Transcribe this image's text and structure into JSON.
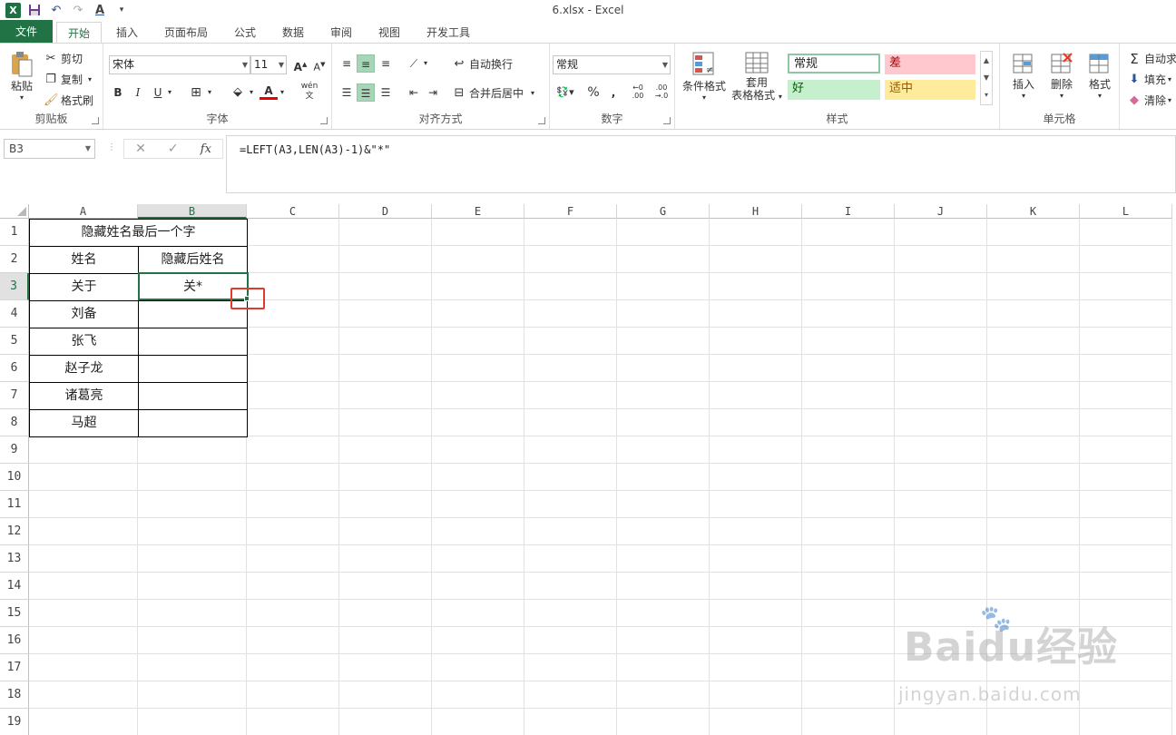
{
  "window": {
    "title": "6.xlsx - Excel"
  },
  "qat": {
    "logo": "X",
    "undo": "↶",
    "redo": "↷",
    "font_color_btn": "A"
  },
  "tabs": [
    "文件",
    "开始",
    "插入",
    "页面布局",
    "公式",
    "数据",
    "审阅",
    "视图",
    "开发工具"
  ],
  "ribbon": {
    "clipboard": {
      "paste": "粘贴",
      "cut": "剪切",
      "copy": "复制",
      "format_painter": "格式刷",
      "label": "剪贴板"
    },
    "font": {
      "font_name": "宋体",
      "font_size": "11",
      "bold": "B",
      "italic": "I",
      "underline": "U",
      "font_color": "A",
      "phonetic": "wén",
      "label": "字体"
    },
    "alignment": {
      "wrap": "自动换行",
      "merge": "合并后居中",
      "label": "对齐方式"
    },
    "number": {
      "format": "常规",
      "percent": "%",
      "comma": ",",
      "label": "数字"
    },
    "styles": {
      "conditional": "条件格式",
      "table_line1": "套用",
      "table_line2": "表格格式",
      "normal": "常规",
      "bad": "差",
      "good": "好",
      "neutral": "适中",
      "label": "样式"
    },
    "cells": {
      "insert": "插入",
      "delete": "删除",
      "format": "格式",
      "label": "单元格"
    },
    "editing": {
      "autosum": "自动求",
      "fill": "填充",
      "clear": "清除"
    }
  },
  "formula_bar": {
    "name_box": "B3",
    "formula": "=LEFT(A3,LEN(A3)-1)&\"*\"",
    "cancel": "✕",
    "enter": "✓",
    "fx": "fx"
  },
  "columns": [
    "A",
    "B",
    "C",
    "D",
    "E",
    "F",
    "G",
    "H",
    "I",
    "J",
    "K",
    "L"
  ],
  "rows": [
    "1",
    "2",
    "3",
    "4",
    "5",
    "6",
    "7",
    "8",
    "9",
    "10",
    "11",
    "12",
    "13",
    "14",
    "15",
    "16",
    "17",
    "18",
    "19"
  ],
  "sheet": {
    "title": "隐藏姓名最后一个字",
    "header_a": "姓名",
    "header_b": "隐藏后姓名",
    "names": [
      "关于",
      "刘备",
      "张飞",
      "赵子龙",
      "诸葛亮",
      "马超"
    ],
    "results": [
      "关*",
      "",
      "",
      "",
      "",
      ""
    ]
  },
  "selected_cell": "B3",
  "watermark": {
    "brand": "Baidu经验",
    "url": "jingyan.baidu.com"
  }
}
